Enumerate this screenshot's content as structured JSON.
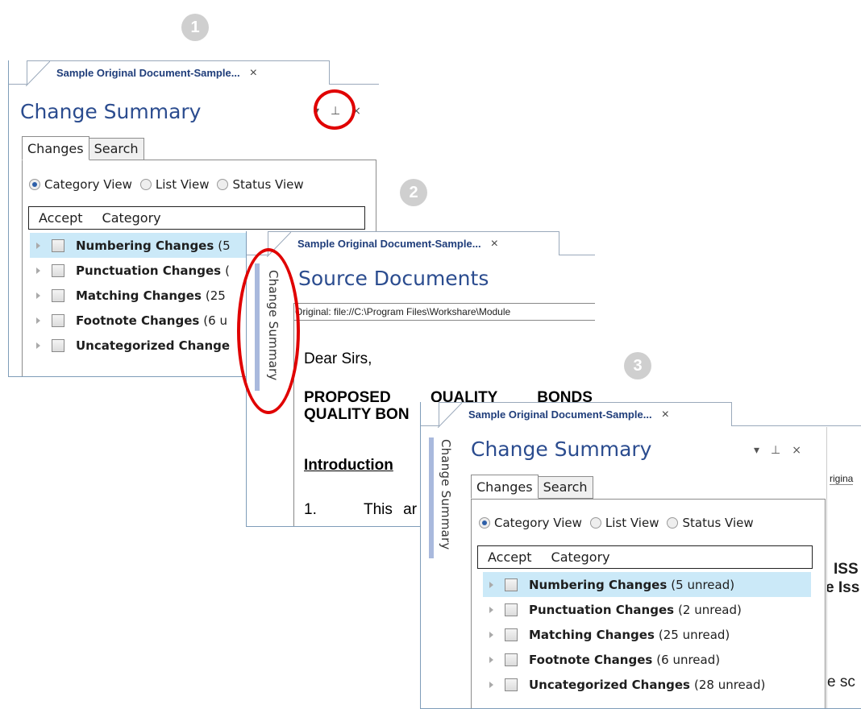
{
  "steps": [
    "1",
    "2",
    "3"
  ],
  "doc_tab_title": "Sample Original Document-Sample...",
  "close_glyph": "×",
  "pin_glyph": "⊥",
  "dropdown_glyph": "▾",
  "panel1": {
    "title": "Change Summary",
    "tabs": [
      "Changes",
      "Search"
    ],
    "views": [
      "Category View",
      "List View",
      "Status View"
    ],
    "selected_view": "Category View",
    "header": [
      "Accept",
      "Category"
    ],
    "rows": [
      {
        "name": "Numbering Changes",
        "count": "(5"
      },
      {
        "name": "Punctuation Changes",
        "count": "("
      },
      {
        "name": "Matching Changes",
        "count": "(25"
      },
      {
        "name": "Footnote Changes",
        "count": "(6 u"
      },
      {
        "name": "Uncategorized Change",
        "count": ""
      }
    ]
  },
  "panel2": {
    "title": "Source Documents",
    "side_label": "Change Summary",
    "path": "Original: file://C:\\Program Files\\Workshare\\Module",
    "greeting": "Dear Sirs,",
    "heading_line1": "PROPOSED QUALITY BONDS",
    "heading_line2": "QUALITY BON",
    "section": "Introduction",
    "para_num": "1.",
    "para_text": "This ar"
  },
  "panel3": {
    "title": "Change Summary",
    "side_label": "Change Summary",
    "tabs": [
      "Changes",
      "Search"
    ],
    "views": [
      "Category View",
      "List View",
      "Status View"
    ],
    "selected_view": "Category View",
    "header": [
      "Accept",
      "Category"
    ],
    "bg_fragments": [
      "rigina",
      "ISS",
      "e Iss",
      "e sc"
    ],
    "rows": [
      {
        "name": "Numbering Changes",
        "count": "(5 unread)"
      },
      {
        "name": "Punctuation Changes",
        "count": "(2 unread)"
      },
      {
        "name": "Matching Changes",
        "count": "(25 unread)"
      },
      {
        "name": "Footnote Changes",
        "count": "(6 unread)"
      },
      {
        "name": "Uncategorized Changes",
        "count": "(28 unread)"
      }
    ]
  },
  "colors": {
    "highlight": "#cbe9f8",
    "title_blue": "#2b4c8f",
    "annotation_red": "#e00000",
    "side_strip": "#a9b9dd"
  }
}
